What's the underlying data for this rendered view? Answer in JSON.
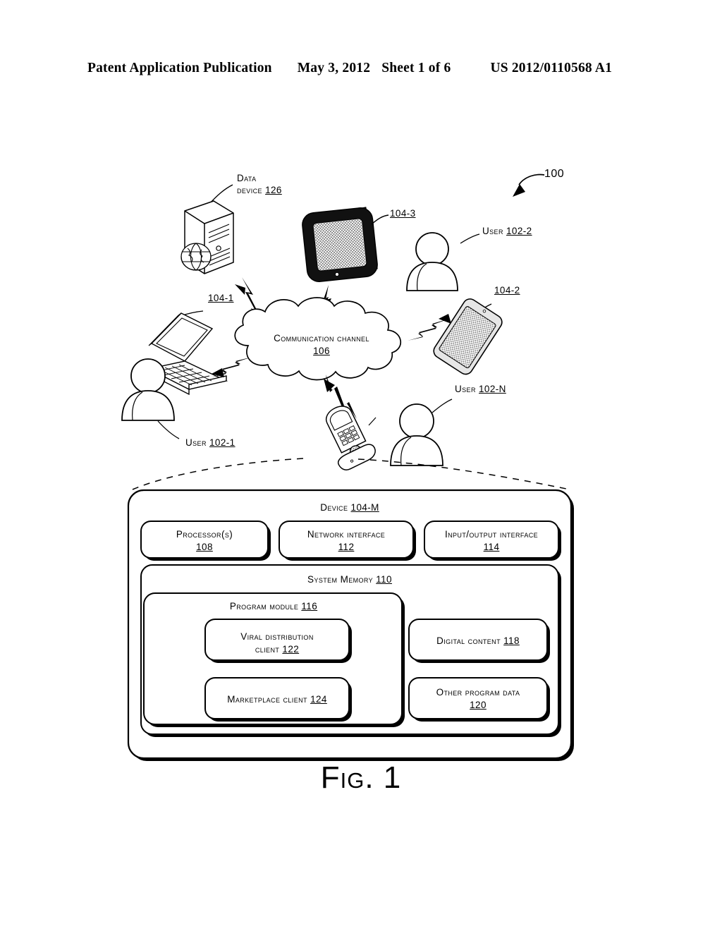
{
  "header": {
    "publication": "Patent Application Publication",
    "date": "May 3, 2012",
    "sheet": "Sheet 1 of 6",
    "number": "US 2012/0110568 A1"
  },
  "figure": {
    "caption": "Fig. 1",
    "system_ref": "100",
    "nodes": {
      "data_device": {
        "name": "Data",
        "name2": "device",
        "ref": "126"
      },
      "tablet": {
        "ref": "104-3"
      },
      "laptop": {
        "ref": "104-1"
      },
      "phone_user2": {
        "ref": "104-2"
      },
      "user_1": {
        "label": "User",
        "ref": "102-1"
      },
      "user_2": {
        "label": "User",
        "ref": "102-2"
      },
      "user_n": {
        "label": "User",
        "ref": "102-N"
      },
      "cloud": {
        "label": "Communication channel",
        "ref": "106"
      }
    },
    "device_block": {
      "title": "Device",
      "title_ref": "104-M",
      "top_row": [
        {
          "label": "Processor(s)",
          "ref": "108"
        },
        {
          "label": "Network interface",
          "ref": "112"
        },
        {
          "label": "Input/output interface",
          "ref": "114"
        }
      ],
      "system_memory": {
        "label": "System Memory",
        "ref": "110"
      },
      "program_module": {
        "label": "Program module",
        "ref": "116"
      },
      "program_items": [
        {
          "label": "Viral distribution",
          "label2": "client",
          "ref": "122"
        },
        {
          "label": "Marketplace client",
          "ref": "124"
        }
      ],
      "data_items": [
        {
          "label": "Digital content",
          "ref": "118"
        },
        {
          "label": "Other program data",
          "ref": "120"
        }
      ]
    }
  },
  "colors": {
    "ink": "#000000",
    "paper": "#ffffff",
    "screen_fill": "#b9b9b9",
    "bezel": "#111111"
  }
}
